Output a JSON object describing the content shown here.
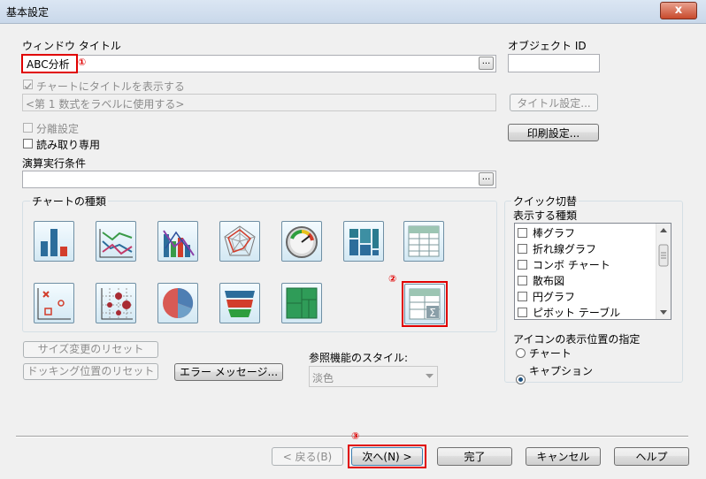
{
  "window": {
    "title": "基本設定",
    "close_label": "x"
  },
  "window_title_section": {
    "label": "ウィンドウ タイトル",
    "value": "ABC分析",
    "marker": "①",
    "browse_label": "..."
  },
  "object_id": {
    "label": "オブジェクト ID",
    "value": ""
  },
  "show_title": {
    "label": "チャートにタイトルを表示する",
    "checked": true,
    "placeholder": "<第 1 数式をラベルに使用する>",
    "settings_button": "タイトル設定..."
  },
  "split_setting": {
    "label": "分離設定"
  },
  "read_only": {
    "label": "読み取り専用"
  },
  "print_settings_button": "印刷設定...",
  "calc_condition": {
    "label": "演算実行条件",
    "value": "",
    "browse_label": "..."
  },
  "chart_types": {
    "label": "チャートの種類",
    "marker": "②",
    "icons": [
      "bar-chart-icon",
      "line-chart-icon",
      "combo-chart-icon",
      "radar-chart-icon",
      "gauge-chart-icon",
      "mekko-chart-icon",
      "pivot-table-icon",
      "scatter-chart-icon",
      "grid-chart-icon",
      "pie-chart-icon",
      "funnel-chart-icon",
      "block-chart-icon",
      "straight-table-icon"
    ]
  },
  "quick_switch": {
    "label": "クイック切替",
    "types_label": "表示する種類",
    "items": [
      "棒グラフ",
      "折れ線グラフ",
      "コンボ チャート",
      "散布図",
      "円グラフ",
      "ピボット テーブル"
    ],
    "icon_pos_label": "アイコンの表示位置の指定",
    "options": [
      "チャート",
      "キャプション"
    ],
    "selected_option": "キャプション"
  },
  "reset_size_button": "サイズ変更のリセット",
  "reset_docking_button": "ドッキング位置のリセット",
  "error_message_button": "エラー メッセージ...",
  "ref_style": {
    "label": "参照機能のスタイル:",
    "value": "淡色"
  },
  "footer": {
    "marker": "③",
    "back": "< 戻る(B)",
    "next": "次へ(N) >",
    "finish": "完了",
    "cancel": "キャンセル",
    "help": "ヘルプ"
  }
}
